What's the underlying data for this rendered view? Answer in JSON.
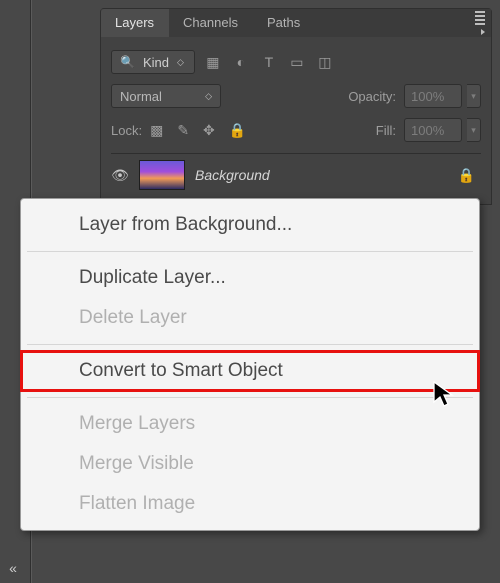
{
  "tabs": {
    "layers": "Layers",
    "channels": "Channels",
    "paths": "Paths"
  },
  "filter": {
    "label": "Kind"
  },
  "filterIcons": {
    "pixel": "pixel-layers",
    "adjust": "adjustment-layers",
    "type": "type-layers",
    "shape": "shape-layers",
    "smart": "smart-objects"
  },
  "blend": {
    "mode": "Normal",
    "opacityLabel": "Opacity:",
    "opacityValue": "100%"
  },
  "lock": {
    "label": "Lock:",
    "fillLabel": "Fill:",
    "fillValue": "100%"
  },
  "layer": {
    "name": "Background"
  },
  "ctx": {
    "layerFromBg": "Layer from Background...",
    "duplicate": "Duplicate Layer...",
    "delete": "Delete Layer",
    "convertSmart": "Convert to Smart Object",
    "mergeLayers": "Merge Layers",
    "mergeVisible": "Merge Visible",
    "flatten": "Flatten Image"
  }
}
